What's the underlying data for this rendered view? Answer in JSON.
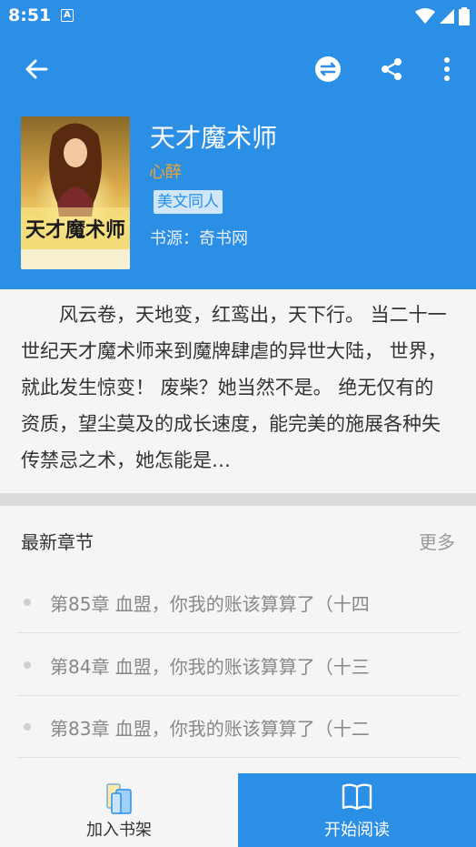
{
  "status_bar": {
    "time": "8:51",
    "notification": "A"
  },
  "book": {
    "title": "天才魔术师",
    "author": "心醉",
    "tag": "美文同人",
    "source": "书源：奇书网",
    "cover_text": "天才魔术师"
  },
  "intro": {
    "text": "风云卷，天地变，红鸾出，天下行。 当二十一世纪天才魔术师来到魔牌肆虐的异世大陆， 世界，就此发生惊变！ 废柴？她当然不是。 绝无仅有的资质，望尘莫及的成长速度，能完美的施展各种失传禁忌之术，她怎能是…"
  },
  "chapters": {
    "title": "最新章节",
    "more": "更多",
    "items": [
      {
        "label": "第85章 血盟，你我的账该算算了（十四"
      },
      {
        "label": "第84章 血盟，你我的账该算算了（十三"
      },
      {
        "label": "第83章 血盟，你我的账该算算了（十二"
      }
    ]
  },
  "bottom": {
    "shelf_label": "加入书架",
    "read_label": "开始阅读"
  },
  "colors": {
    "primary": "#2b8fe6",
    "author": "#f5a623"
  }
}
